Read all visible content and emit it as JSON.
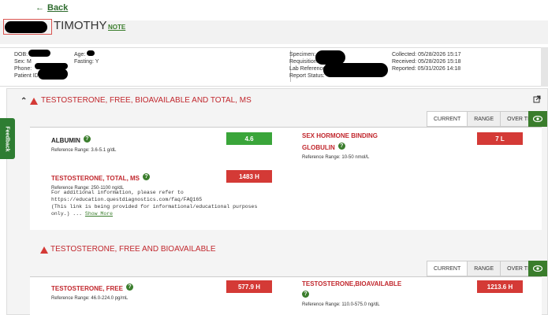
{
  "nav": {
    "back_label": "Back"
  },
  "patient": {
    "name": "TIMOTHY",
    "note_label": "NOTE"
  },
  "info": {
    "dob_label": "DOB:",
    "sex_label": "Sex:",
    "sex_value": "M",
    "phone_label": "Phone:",
    "patient_id_label": "Patient ID:",
    "age_label": "Age:",
    "fasting_label": "Fasting:",
    "fasting_value": "Y",
    "specimen_label": "Specimen:",
    "requisition_label": "Requisition:",
    "lab_ref_label": "Lab Reference:",
    "report_status_label": "Report Status:",
    "collected": "Collected: 05/28/2026 15:17",
    "received": "Received: 05/28/2026 15:18",
    "reported": "Reported: 05/31/2026 14:18"
  },
  "section1": {
    "title": "TESTOSTERONE, FREE, BIOAVAILABLE AND TOTAL, MS",
    "tabs": [
      "CURRENT",
      "RANGE",
      "OVER TIME"
    ],
    "tests": [
      {
        "name": "ALBUMIN",
        "range": "Reference Range: 3.6-5.1 g/dL",
        "value": "4.6"
      },
      {
        "name1": "SEX HORMONE BINDING",
        "name2": "GLOBULIN",
        "range": "Reference Range: 10-50 nmol/L",
        "value": "7 L"
      },
      {
        "name": "TESTOSTERONE, TOTAL, MS",
        "range": "Reference Range: 250-1100 ng/dL",
        "value": "1483 H"
      }
    ],
    "comment": [
      "For additional information, please refer to",
      "https://education.questdiagnostics.com/faq/FAQ165",
      "(This link is being provided for informational/educational purposes",
      "only.)  ..."
    ],
    "show_more": "Show More"
  },
  "section2": {
    "title": "TESTOSTERONE, FREE AND BIOAVAILABLE",
    "tabs": [
      "CURRENT",
      "RANGE",
      "OVER TIME"
    ],
    "tests": [
      {
        "name": "TESTOSTERONE, FREE",
        "range": "Reference Range: 46.0-224.0 pg/mL",
        "value": "577.9 H"
      },
      {
        "name": "TESTOSTERONE,BIOAVAILABLE",
        "range": "Reference Range: 110.0-575.0 ng/dL",
        "value": "1213.6 H"
      }
    ]
  },
  "feedback": {
    "label": "Feedback"
  },
  "colors": {
    "brand_green": "#3a7d2c",
    "alert_red": "#d43a36",
    "normal_green": "#3aa53a"
  },
  "icons": [
    "back-arrow-icon",
    "help-icon",
    "warning-icon",
    "chevron-up-icon",
    "external-link-icon",
    "eye-icon"
  ]
}
